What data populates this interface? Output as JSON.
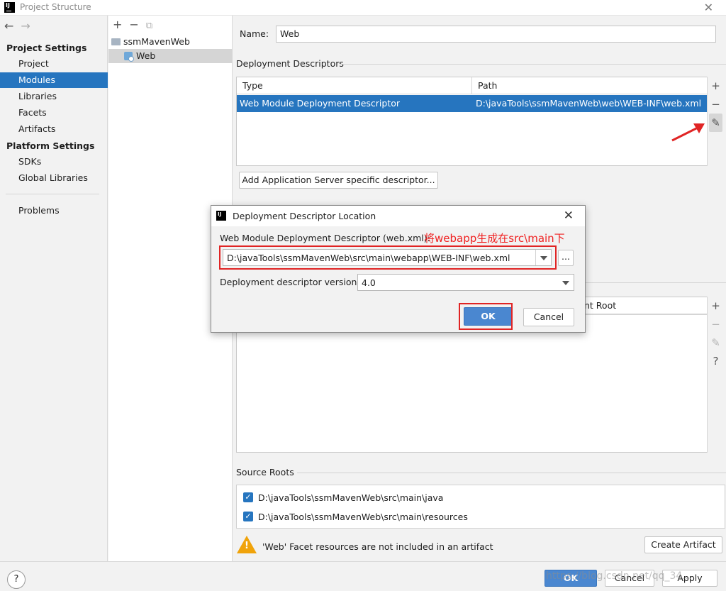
{
  "window": {
    "title": "Project Structure"
  },
  "nav": {
    "project_settings": "Project Settings",
    "items_project": [
      "Project",
      "Modules",
      "Libraries",
      "Facets",
      "Artifacts"
    ],
    "platform_settings": "Platform Settings",
    "items_platform": [
      "SDKs",
      "Global Libraries"
    ],
    "problems": "Problems",
    "selected": "Modules"
  },
  "tree": {
    "root": "ssmMavenWeb",
    "child": "Web"
  },
  "main": {
    "name_label": "Name:",
    "name_value": "Web",
    "deploy_title": "Deployment Descriptors",
    "table_headers": {
      "type": "Type",
      "path": "Path"
    },
    "row": {
      "type": "Web Module Deployment Descriptor",
      "path": "D:\\javaTools\\ssmMavenWeb\\web\\WEB-INF\\web.xml"
    },
    "add_server_btn": "Add Application Server specific descriptor...",
    "web_root_header_partial": "nt Root",
    "source_roots_title": "Source Roots",
    "source_roots": [
      "D:\\javaTools\\ssmMavenWeb\\src\\main\\java",
      "D:\\javaTools\\ssmMavenWeb\\src\\main\\resources"
    ],
    "warning_text": "'Web' Facet resources are not included in an artifact",
    "create_artifact_btn": "Create Artifact"
  },
  "dialog": {
    "title": "Deployment Descriptor Location",
    "descriptor_label": "Web Module Deployment Descriptor (web.xml):",
    "annotation": "将webapp生成在src\\main下",
    "descriptor_value": "D:\\javaTools\\ssmMavenWeb\\src\\main\\webapp\\WEB-INF\\web.xml",
    "browse": "...",
    "version_label": "Deployment descriptor version",
    "version_value": "4.0",
    "ok": "OK",
    "cancel": "Cancel"
  },
  "bottom": {
    "help": "?",
    "ok": "OK",
    "cancel": "Cancel",
    "apply": "Apply",
    "watermark": "https://blog.csdn.net/qq_34..."
  },
  "colors": {
    "selection": "#2675bf",
    "annotation_red": "#e02424",
    "warning": "#f0a30a"
  }
}
